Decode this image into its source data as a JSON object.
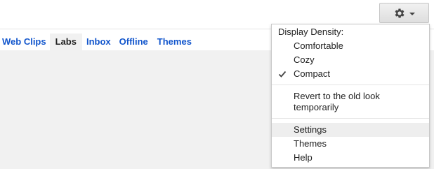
{
  "tabs": [
    {
      "label": "Web Clips",
      "active": false
    },
    {
      "label": "Labs",
      "active": true
    },
    {
      "label": "Inbox",
      "active": false
    },
    {
      "label": "Offline",
      "active": false
    },
    {
      "label": "Themes",
      "active": false
    }
  ],
  "gear_button": {
    "icon": "gear-icon",
    "dropdown_icon": "chevron-down-icon"
  },
  "menu": {
    "density_header": "Display Density:",
    "density_options": [
      {
        "label": "Comfortable",
        "checked": false
      },
      {
        "label": "Cozy",
        "checked": false
      },
      {
        "label": "Compact",
        "checked": true
      }
    ],
    "revert_line1": "Revert to the old look",
    "revert_line2": "temporarily",
    "items": [
      {
        "label": "Settings",
        "highlighted": true
      },
      {
        "label": "Themes",
        "highlighted": false
      },
      {
        "label": "Help",
        "highlighted": false
      }
    ]
  },
  "colors": {
    "link_blue": "#1155cc",
    "panel_gray": "#f1f1f1",
    "menu_highlight": "#eeeeee"
  }
}
